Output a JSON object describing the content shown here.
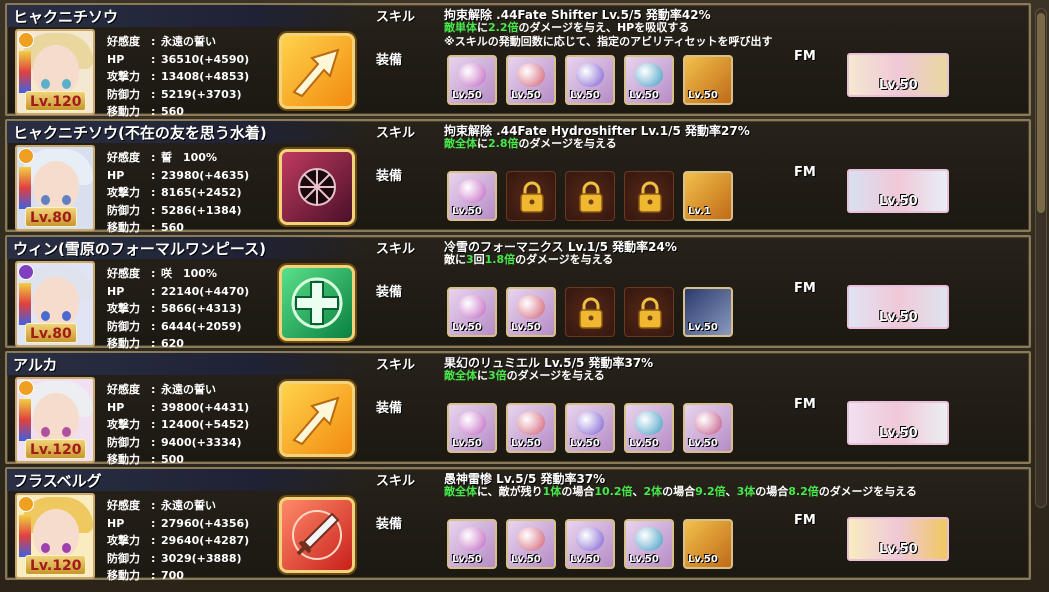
{
  "labels": {
    "skill": "スキル",
    "equip": "装備",
    "fm": "FM"
  },
  "characters": [
    {
      "name": "ヒャクニチソウ",
      "level": "Lv.120",
      "affection": "永遠の誓い",
      "hp": "36510(+4590)",
      "atk": "13408(+4853)",
      "def": "5219(+3703)",
      "move": "560",
      "skill_name": "拘束解除 .44Fate Shifter Lv.5/5 発動率42%",
      "desc_parts": [
        [
          "g",
          "敵単体"
        ],
        [
          "",
          "に"
        ],
        [
          "g",
          "2.2倍"
        ],
        [
          "",
          "のダメージを与え、HPを吸収する"
        ]
      ],
      "desc2": "※スキルの発動回数に応じて、指定のアビリティセットを呼び出す",
      "equip": [
        [
          "item",
          "Lv.50"
        ],
        [
          "item",
          "Lv.50"
        ],
        [
          "item",
          "Lv.50"
        ],
        [
          "item",
          "Lv.50"
        ],
        [
          "weapon",
          "Lv.50"
        ]
      ],
      "fm_level": "Lv.50",
      "skill_type": "arrow"
    },
    {
      "name": "ヒャクニチソウ(不在の友を思う水着)",
      "level": "Lv.80",
      "affection": "誓　100%",
      "hp": "23980(+4635)",
      "atk": "8165(+2452)",
      "def": "5286(+1384)",
      "move": "560",
      "skill_name": "拘束解除 .44Fate Hydroshifter Lv.1/5 発動率27%",
      "desc_parts": [
        [
          "g",
          "敵全体"
        ],
        [
          "",
          "に"
        ],
        [
          "g",
          "2.8倍"
        ],
        [
          "",
          "のダメージを与える"
        ]
      ],
      "desc2": "",
      "equip": [
        [
          "item",
          "Lv.50"
        ],
        [
          "lock",
          ""
        ],
        [
          "lock",
          ""
        ],
        [
          "lock",
          ""
        ],
        [
          "weapon",
          "Lv.1"
        ]
      ],
      "fm_level": "Lv.50",
      "skill_type": "dark"
    },
    {
      "name": "ウィン(雪原のフォーマルワンピース)",
      "level": "Lv.80",
      "affection": "咲　100%",
      "hp": "22140(+4470)",
      "atk": "5866(+4313)",
      "def": "6444(+2059)",
      "move": "620",
      "skill_name": "冷雪のフォーマニクス Lv.1/5 発動率24%",
      "desc_parts": [
        [
          "",
          "敵に"
        ],
        [
          "g",
          "3"
        ],
        [
          "",
          "回"
        ],
        [
          "g",
          "1.8倍"
        ],
        [
          "",
          "のダメージを与える"
        ]
      ],
      "desc2": "",
      "equip": [
        [
          "item",
          "Lv.50"
        ],
        [
          "item",
          "Lv.50"
        ],
        [
          "lock",
          ""
        ],
        [
          "lock",
          ""
        ],
        [
          "card",
          "Lv.50"
        ]
      ],
      "fm_level": "Lv.50",
      "skill_type": "cross"
    },
    {
      "name": "アルカ",
      "level": "Lv.120",
      "affection": "永遠の誓い",
      "hp": "39800(+4431)",
      "atk": "12400(+5452)",
      "def": "9400(+3334)",
      "move": "500",
      "skill_name": "果幻のリュミエル Lv.5/5 発動率37%",
      "desc_parts": [
        [
          "g",
          "敵全体"
        ],
        [
          "",
          "に"
        ],
        [
          "g",
          "3倍"
        ],
        [
          "",
          "のダメージを与える"
        ]
      ],
      "desc2": "",
      "equip": [
        [
          "item",
          "Lv.50"
        ],
        [
          "item",
          "Lv.50"
        ],
        [
          "item",
          "Lv.50"
        ],
        [
          "item",
          "Lv.50"
        ],
        [
          "item",
          "Lv.50"
        ]
      ],
      "fm_level": "Lv.50",
      "skill_type": "arrow"
    },
    {
      "name": "フラスベルグ",
      "level": "Lv.120",
      "affection": "永遠の誓い",
      "hp": "27960(+4356)",
      "atk": "29640(+4287)",
      "def": "3029(+3888)",
      "move": "700",
      "skill_name": "愚神雷惨 Lv.5/5 発動率37%",
      "desc_parts": [
        [
          "g",
          "敵全体"
        ],
        [
          "",
          "に、敵が残り"
        ],
        [
          "g",
          "1体"
        ],
        [
          "",
          "の場合"
        ],
        [
          "g",
          "10.2倍"
        ],
        [
          "",
          "、"
        ],
        [
          "g",
          "2体"
        ],
        [
          "",
          "の場合"
        ],
        [
          "g",
          "9.2倍"
        ],
        [
          "",
          "、"
        ],
        [
          "g",
          "3体"
        ],
        [
          "",
          "の場合"
        ],
        [
          "g",
          "8.2倍"
        ],
        [
          "",
          "のダメージを与える"
        ]
      ],
      "desc2": "",
      "equip": [
        [
          "item",
          "Lv.50"
        ],
        [
          "item",
          "Lv.50"
        ],
        [
          "item",
          "Lv.50"
        ],
        [
          "item",
          "Lv.50"
        ],
        [
          "weapon",
          "Lv.50"
        ]
      ],
      "fm_level": "Lv.50",
      "skill_type": "sword"
    }
  ],
  "stat_labels": {
    "affection": "好感度",
    "hp": "HP",
    "atk": "攻撃力",
    "def": "防御力",
    "move": "移動力"
  },
  "theme": {
    "panel_border": "#8a7a58",
    "green": "#46e84a",
    "gold": "#f2d27a"
  }
}
